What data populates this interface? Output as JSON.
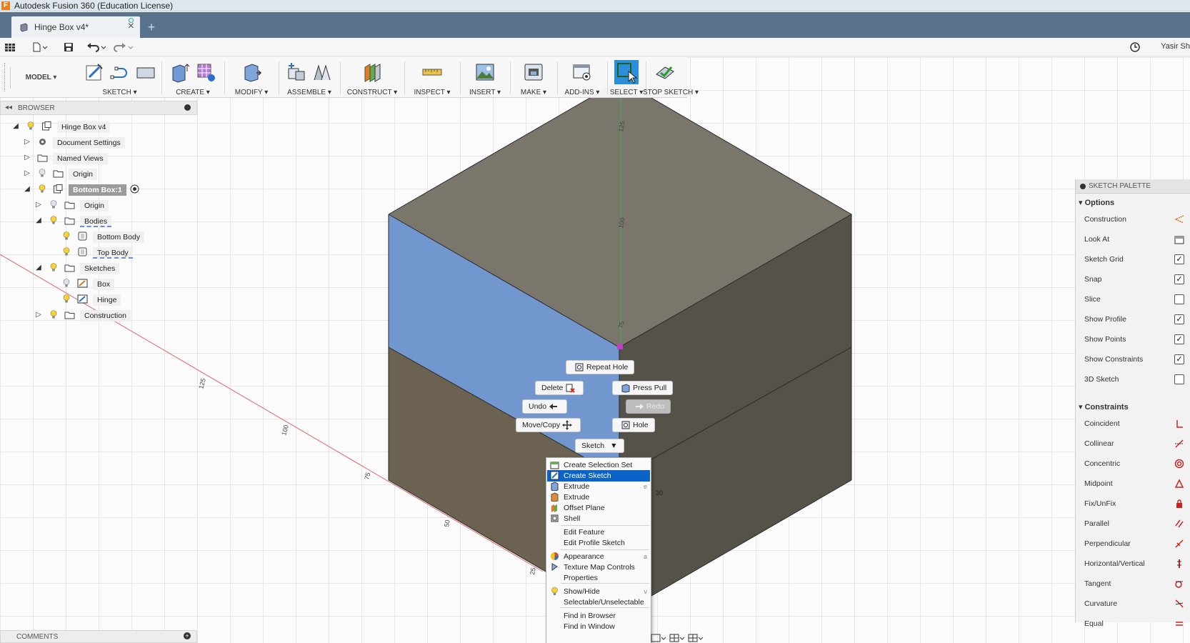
{
  "window": {
    "title": "Autodesk Fusion 360 (Education License)"
  },
  "tab": {
    "title": "Hinge Box v4*"
  },
  "quick_access": {
    "user": "Yasir Sh"
  },
  "toolbar": {
    "workspace": "MODEL ▾",
    "groups": [
      "SKETCH ▾",
      "CREATE ▾",
      "MODIFY ▾",
      "ASSEMBLE ▾",
      "CONSTRUCT ▾",
      "INSPECT ▾",
      "INSERT ▾",
      "MAKE ▾",
      "ADD-INS ▾",
      "SELECT ▾",
      "STOP SKETCH ▾"
    ]
  },
  "browser": {
    "title": "BROWSER",
    "nodes": [
      "Hinge Box v4",
      "Document Settings",
      "Named Views",
      "Origin",
      "Bottom Box:1",
      "Origin",
      "Bodies",
      "Bottom Body",
      "Top Body",
      "Sketches",
      "Box",
      "Hinge",
      "Construction"
    ]
  },
  "comments": {
    "title": "COMMENTS"
  },
  "palette": {
    "title": "SKETCH PALETTE",
    "options_label": "Options",
    "options": [
      {
        "label": "Construction",
        "checked": null
      },
      {
        "label": "Look At",
        "checked": null
      },
      {
        "label": "Sketch Grid",
        "checked": true
      },
      {
        "label": "Snap",
        "checked": true
      },
      {
        "label": "Slice",
        "checked": false
      },
      {
        "label": "Show Profile",
        "checked": true
      },
      {
        "label": "Show Points",
        "checked": true
      },
      {
        "label": "Show Constraints",
        "checked": true
      },
      {
        "label": "3D Sketch",
        "checked": false
      }
    ],
    "constraints_label": "Constraints",
    "constraints": [
      "Coincident",
      "Collinear",
      "Concentric",
      "Midpoint",
      "Fix/UnFix",
      "Parallel",
      "Perpendicular",
      "Horizontal/Vertical",
      "Tangent",
      "Curvature",
      "Equal"
    ]
  },
  "marking_menu": {
    "repeat": "Repeat Hole",
    "delete": "Delete",
    "press_pull": "Press Pull",
    "undo": "Undo",
    "redo": "Redo",
    "move_copy": "Move/Copy",
    "hole": "Hole",
    "sketch": "Sketch"
  },
  "context_menu": {
    "items": [
      {
        "label": "Create Selection Set",
        "shortcut": ""
      },
      {
        "label": "Create Sketch",
        "shortcut": ""
      },
      {
        "label": "Extrude",
        "shortcut": "e"
      },
      {
        "label": "Extrude",
        "shortcut": ""
      },
      {
        "label": "Offset Plane",
        "shortcut": ""
      },
      {
        "label": "Shell",
        "shortcut": ""
      },
      {
        "label": "Edit Feature",
        "shortcut": ""
      },
      {
        "label": "Edit Profile Sketch",
        "shortcut": ""
      },
      {
        "label": "Appearance",
        "shortcut": "a"
      },
      {
        "label": "Texture Map Controls",
        "shortcut": ""
      },
      {
        "label": "Properties",
        "shortcut": ""
      },
      {
        "label": "Show/Hide",
        "shortcut": "v"
      },
      {
        "label": "Selectable/Unselectable",
        "shortcut": ""
      },
      {
        "label": "Find in Browser",
        "shortcut": ""
      },
      {
        "label": "Find in Window",
        "shortcut": ""
      }
    ]
  },
  "viewport": {
    "axis_labels": [
      "125",
      "100",
      "75",
      "50",
      "25",
      "125",
      "100",
      "75",
      "30"
    ]
  },
  "colors": {
    "accent": "#0a64c8",
    "tabbar": "#5a738c",
    "selected_face": "#7297cf",
    "body": "#6e6a5e"
  }
}
